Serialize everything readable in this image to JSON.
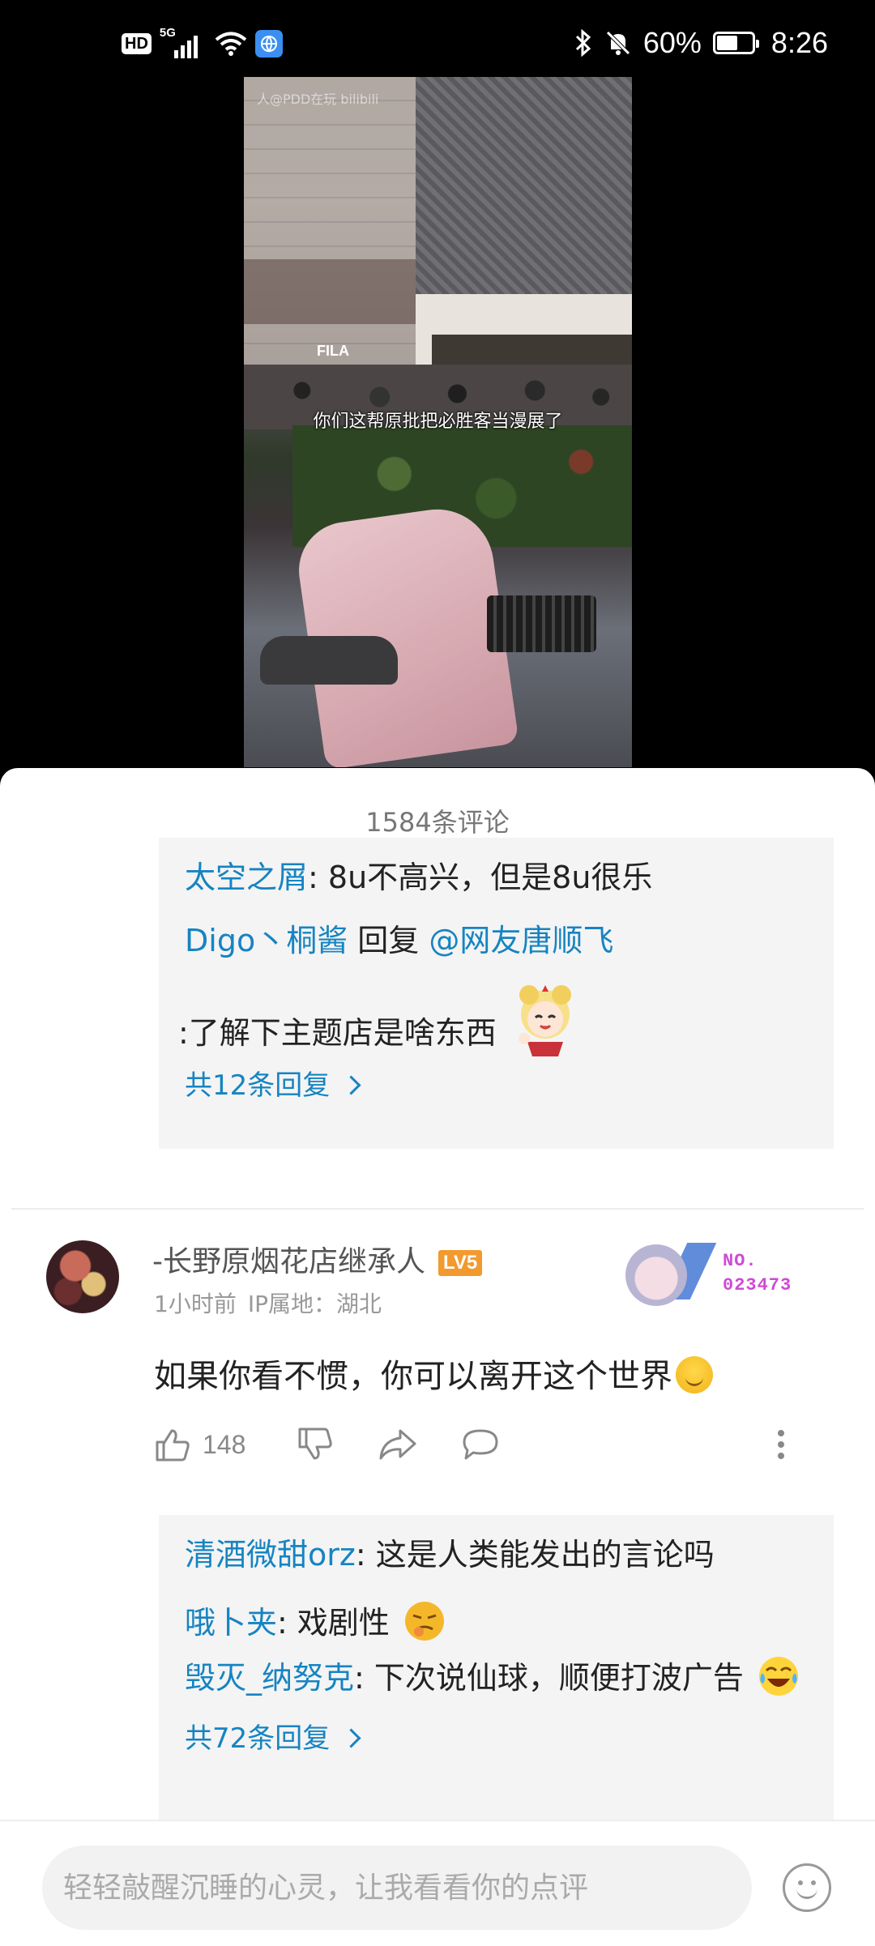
{
  "status_bar": {
    "hd": "HD",
    "network": "5G",
    "battery_percent": "60%",
    "battery_level": 0.6,
    "time": "8:26"
  },
  "video": {
    "watermark": "人@PDD在玩 bilibili",
    "storefront_sign": "FILA",
    "subtitle": "你们这帮原批把必胜客当漫展了"
  },
  "comments": {
    "count_label": "1584条评论",
    "first_thread": {
      "replies": [
        {
          "user": "太空之屑",
          "sep": ": ",
          "text": "8u不高兴，但是8u很乐"
        },
        {
          "user": "Digo丶桐酱",
          "mid": " 回复 ",
          "mention": "@网友唐顺飞",
          "text": " :了解下主题店是啥东西",
          "sticker": "chibi-girl-sticker"
        }
      ],
      "more_label": "共12条回复"
    },
    "main_comment": {
      "author": "-长野原烟花店继承人",
      "level": "LV5",
      "time": "1小时前",
      "ip": "IP属地：湖北",
      "fan_badge_no": "NO.",
      "fan_badge_num": "023473",
      "text": "如果你看不惯，你可以离开这个世界",
      "emoji": "hug-emoji",
      "likes": "148"
    },
    "second_thread": {
      "replies": [
        {
          "user": "清酒微甜orz",
          "text": ": 这是人类能发出的言论吗"
        },
        {
          "user": "哦卜夹",
          "text": ": 戏剧性",
          "emoji": "smirk-emoji"
        },
        {
          "user": "毁灭_纳努克",
          "text": ": 下次说仙球，顺便打波广告",
          "emoji": "laugh-cry-emoji"
        }
      ],
      "more_label": "共72条回复"
    }
  },
  "input": {
    "placeholder": "轻轻敲醒沉睡的心灵，让我看看你的点评"
  },
  "colors": {
    "username_blue": "#1684c2",
    "level_orange": "#f29a2e",
    "badge_pink": "#cf4ad6"
  }
}
